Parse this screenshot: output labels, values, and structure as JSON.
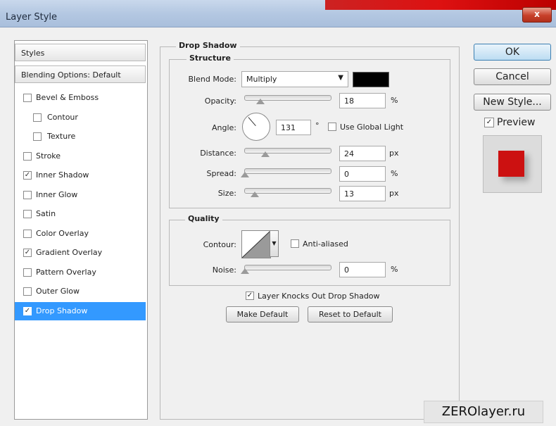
{
  "window": {
    "title": "Layer Style",
    "close_glyph": "x"
  },
  "styles_panel": {
    "header": "Styles",
    "blending": "Blending Options: Default",
    "items": [
      {
        "label": "Bevel & Emboss",
        "checked": false,
        "indent": false
      },
      {
        "label": "Contour",
        "checked": false,
        "indent": true
      },
      {
        "label": "Texture",
        "checked": false,
        "indent": true
      },
      {
        "label": "Stroke",
        "checked": false,
        "indent": false
      },
      {
        "label": "Inner Shadow",
        "checked": true,
        "indent": false
      },
      {
        "label": "Inner Glow",
        "checked": false,
        "indent": false
      },
      {
        "label": "Satin",
        "checked": false,
        "indent": false
      },
      {
        "label": "Color Overlay",
        "checked": false,
        "indent": false
      },
      {
        "label": "Gradient Overlay",
        "checked": true,
        "indent": false
      },
      {
        "label": "Pattern Overlay",
        "checked": false,
        "indent": false
      },
      {
        "label": "Outer Glow",
        "checked": false,
        "indent": false
      },
      {
        "label": "Drop Shadow",
        "checked": true,
        "indent": false,
        "selected": true
      }
    ]
  },
  "drop_shadow": {
    "title": "Drop Shadow",
    "structure": {
      "title": "Structure",
      "blend_mode_label": "Blend Mode:",
      "blend_mode_value": "Multiply",
      "shadow_color": "#000000",
      "opacity_label": "Opacity:",
      "opacity_value": "18",
      "opacity_unit": "%",
      "angle_label": "Angle:",
      "angle_value": "131",
      "angle_unit": "°",
      "global_light_label": "Use Global Light",
      "distance_label": "Distance:",
      "distance_value": "24",
      "distance_unit": "px",
      "spread_label": "Spread:",
      "spread_value": "0",
      "spread_unit": "%",
      "size_label": "Size:",
      "size_value": "13",
      "size_unit": "px"
    },
    "quality": {
      "title": "Quality",
      "contour_label": "Contour:",
      "anti_aliased_label": "Anti-aliased",
      "noise_label": "Noise:",
      "noise_value": "0",
      "noise_unit": "%"
    },
    "knockout_label": "Layer Knocks Out Drop Shadow",
    "make_default": "Make Default",
    "reset_default": "Reset to Default"
  },
  "buttons": {
    "ok": "OK",
    "cancel": "Cancel",
    "new_style": "New Style...",
    "preview": "Preview"
  },
  "preview_color": "#cc1111",
  "watermark": "ZEROlayer.ru"
}
